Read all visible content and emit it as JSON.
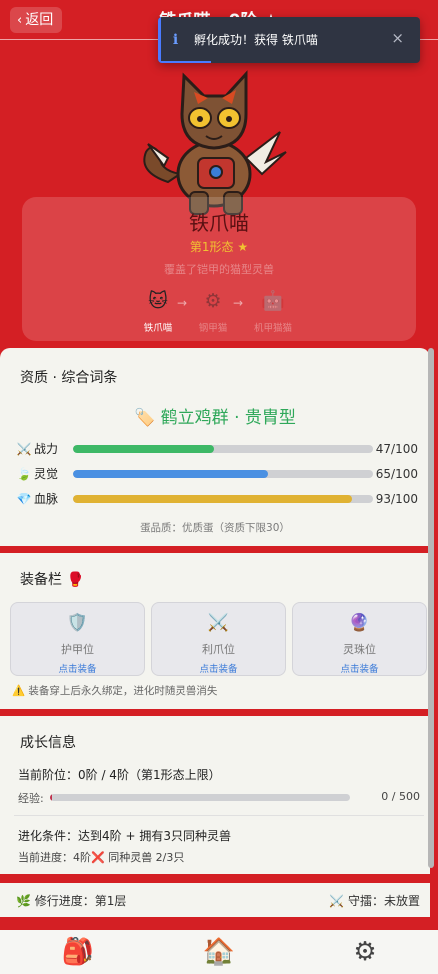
{
  "header": {
    "back_label": "返回",
    "title": "铁爪喵 · 0阶 ★"
  },
  "toast": {
    "message": "孵化成功！获得 铁爪喵",
    "close_glyph": "×",
    "type": "info"
  },
  "pet": {
    "name": "铁爪喵",
    "form_label": "第1形态 ★",
    "description": "覆盖了铠甲的猫型灵兽",
    "evolution": [
      {
        "icon": "cat-face-icon",
        "label": "铁爪喵"
      },
      {
        "icon": "gear-icon",
        "label": "钢甲猫"
      },
      {
        "icon": "robot-icon",
        "label": "机甲猫猫"
      }
    ],
    "arrow_glyph": "→"
  },
  "traits": {
    "section_title": "资质 · 综合词条",
    "title": "鹤立鸡群 · 贵胄型",
    "stats": [
      {
        "icon": "swords-icon",
        "name": "战力",
        "value": 47,
        "max": 100,
        "display": "47/100",
        "color": "#3db866"
      },
      {
        "icon": "leaf-icon",
        "name": "灵觉",
        "value": 65,
        "max": 100,
        "display": "65/100",
        "color": "#4a90e2"
      },
      {
        "icon": "gem-icon",
        "name": "血脉",
        "value": 93,
        "max": 100,
        "display": "93/100",
        "color": "#e0b232"
      }
    ],
    "egg_quality": "蛋品质：优质蛋（资质下限30）"
  },
  "equipment": {
    "section_title": "装备栏 🥊",
    "slots": [
      {
        "icon": "shield-icon",
        "name": "护甲位",
        "action": "点击装备"
      },
      {
        "icon": "crossed-swords-icon",
        "name": "利爪位",
        "action": "点击装备"
      },
      {
        "icon": "crystal-ball-icon",
        "name": "灵珠位",
        "action": "点击装备"
      }
    ],
    "note": "⚠️ 装备穿上后永久绑定，进化时随灵兽消失"
  },
  "growth": {
    "section_title": "成长信息",
    "stage_line": "当前阶位：0阶 / 4阶（第1形态上限）",
    "exp_label": "经验:",
    "exp_value": 0,
    "exp_max": 500,
    "exp_display": "0 / 500",
    "evolve_condition": "进化条件：达到4阶 + 拥有3只同种灵兽",
    "current_progress": "当前进度：4阶❌ 同种灵兽 2/3只"
  },
  "cultivation": {
    "progress": "🌿 修行进度：第1层",
    "guard": "⚔️ 守擂：未放置"
  },
  "nav": {
    "items": [
      {
        "icon": "backpack-icon",
        "glyph": "🎒"
      },
      {
        "icon": "house-icon",
        "glyph": "🏠"
      },
      {
        "icon": "gear-icon",
        "glyph": "⚙"
      }
    ]
  },
  "colors": {
    "background": "#d41f24",
    "panel": "#f4f4ef",
    "accent_green": "#2fa85a",
    "link_blue": "#3a7ad8"
  }
}
